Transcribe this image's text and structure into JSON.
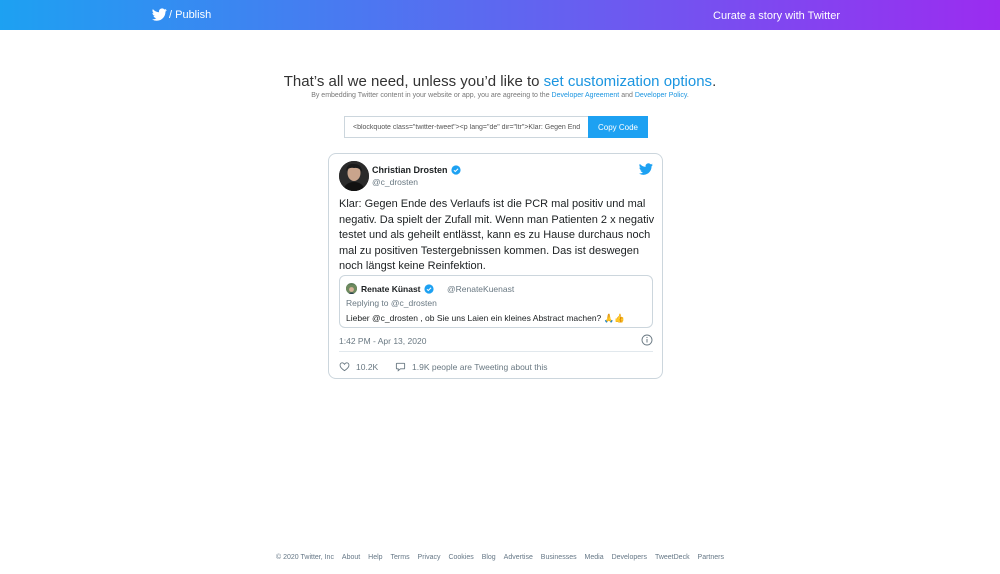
{
  "header": {
    "publish_label": "/ Publish",
    "curate_label": "Curate a story with Twitter"
  },
  "intro": {
    "headline_prefix": "That’s all we need, unless you’d like to ",
    "headline_link": "set customization options",
    "headline_suffix": ".",
    "legal_prefix": "By embedding Twitter content in your website or app, you are agreeing to the ",
    "legal_link1": "Developer Agreement",
    "legal_and": " and ",
    "legal_link2": "Developer Policy",
    "legal_suffix": "."
  },
  "embed": {
    "code_value": "<blockquote class=\"twitter-tweet\"><p lang=\"de\" dir=\"ltr\">Klar: Gegen Ende des Verlaufs ist die PCR mal positiv und mal negativ.",
    "copy_label": "Copy Code"
  },
  "tweet": {
    "author_name": "Christian Drosten",
    "author_handle": "@c_drosten",
    "text": "Klar: Gegen Ende des Verlaufs ist die PCR mal positiv und mal negativ. Da spielt der Zufall mit. Wenn man Patienten 2 x negativ testet und als geheilt entlässt, kann es zu Hause durchaus noch mal zu positiven Testergebnissen kommen. Das ist deswegen noch längst keine Reinfektion.",
    "quoted": {
      "name": "Renate Künast",
      "handle": "@RenateKuenast",
      "replying_to": "Replying to @c_drosten",
      "text": "Lieber @c_drosten , ob Sie uns Laien ein kleines Abstract machen? 🙏👍"
    },
    "timestamp": "1:42 PM - Apr 13, 2020",
    "likes": "10.2K",
    "talking": "1.9K people are Tweeting about this",
    "colors": {
      "accent": "#1da1f2",
      "link": "#1b95e0",
      "muted": "#697882"
    }
  },
  "footer": {
    "items": [
      "© 2020 Twitter, Inc",
      "About",
      "Help",
      "Terms",
      "Privacy",
      "Cookies",
      "Blog",
      "Advertise",
      "Businesses",
      "Media",
      "Developers",
      "TweetDeck",
      "Partners"
    ]
  }
}
